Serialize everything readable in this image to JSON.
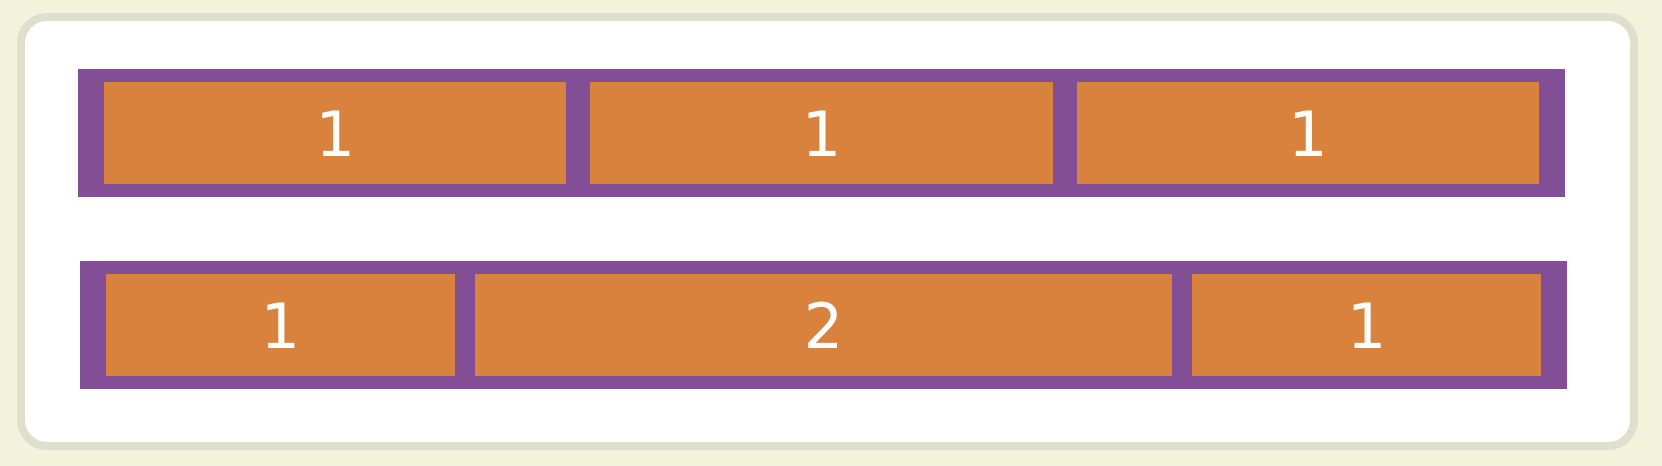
{
  "rows": [
    {
      "items": [
        {
          "label": "1",
          "flex": 1
        },
        {
          "label": "1",
          "flex": 1
        },
        {
          "label": "1",
          "flex": 1
        }
      ]
    },
    {
      "items": [
        {
          "label": "1",
          "flex": 1
        },
        {
          "label": "2",
          "flex": 2
        },
        {
          "label": "1",
          "flex": 1
        }
      ]
    }
  ],
  "colors": {
    "page_background": "#f3f2dc",
    "card_background": "#ffffff",
    "card_border": "#dedfcc",
    "container": "#824f96",
    "item": "#d9823e",
    "item_text": "#ffffff"
  }
}
